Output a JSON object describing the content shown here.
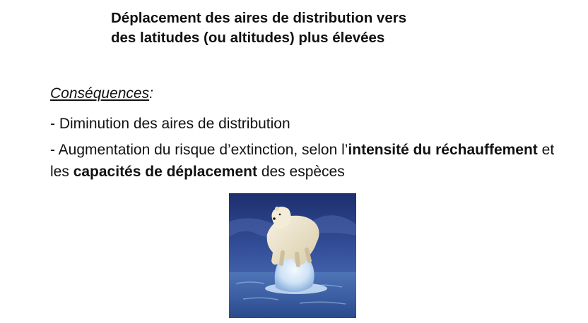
{
  "title": {
    "line1": "Déplacement des aires de distribution vers",
    "line2": "des latitudes (ou altitudes) plus élevées"
  },
  "consequences": {
    "heading": "Conséquences",
    "colon": ":"
  },
  "bullets": {
    "b1": "- Diminution des aires de distribution",
    "b2": {
      "part1": "- Augmentation du risque d’extinction, selon l’",
      "bold1": "intensité du réchauffement",
      "part2": " et les ",
      "bold2": "capacités de déplacement",
      "part3": " des espèces"
    }
  },
  "image": {
    "subject": "polar-bear-on-melting-ice"
  }
}
